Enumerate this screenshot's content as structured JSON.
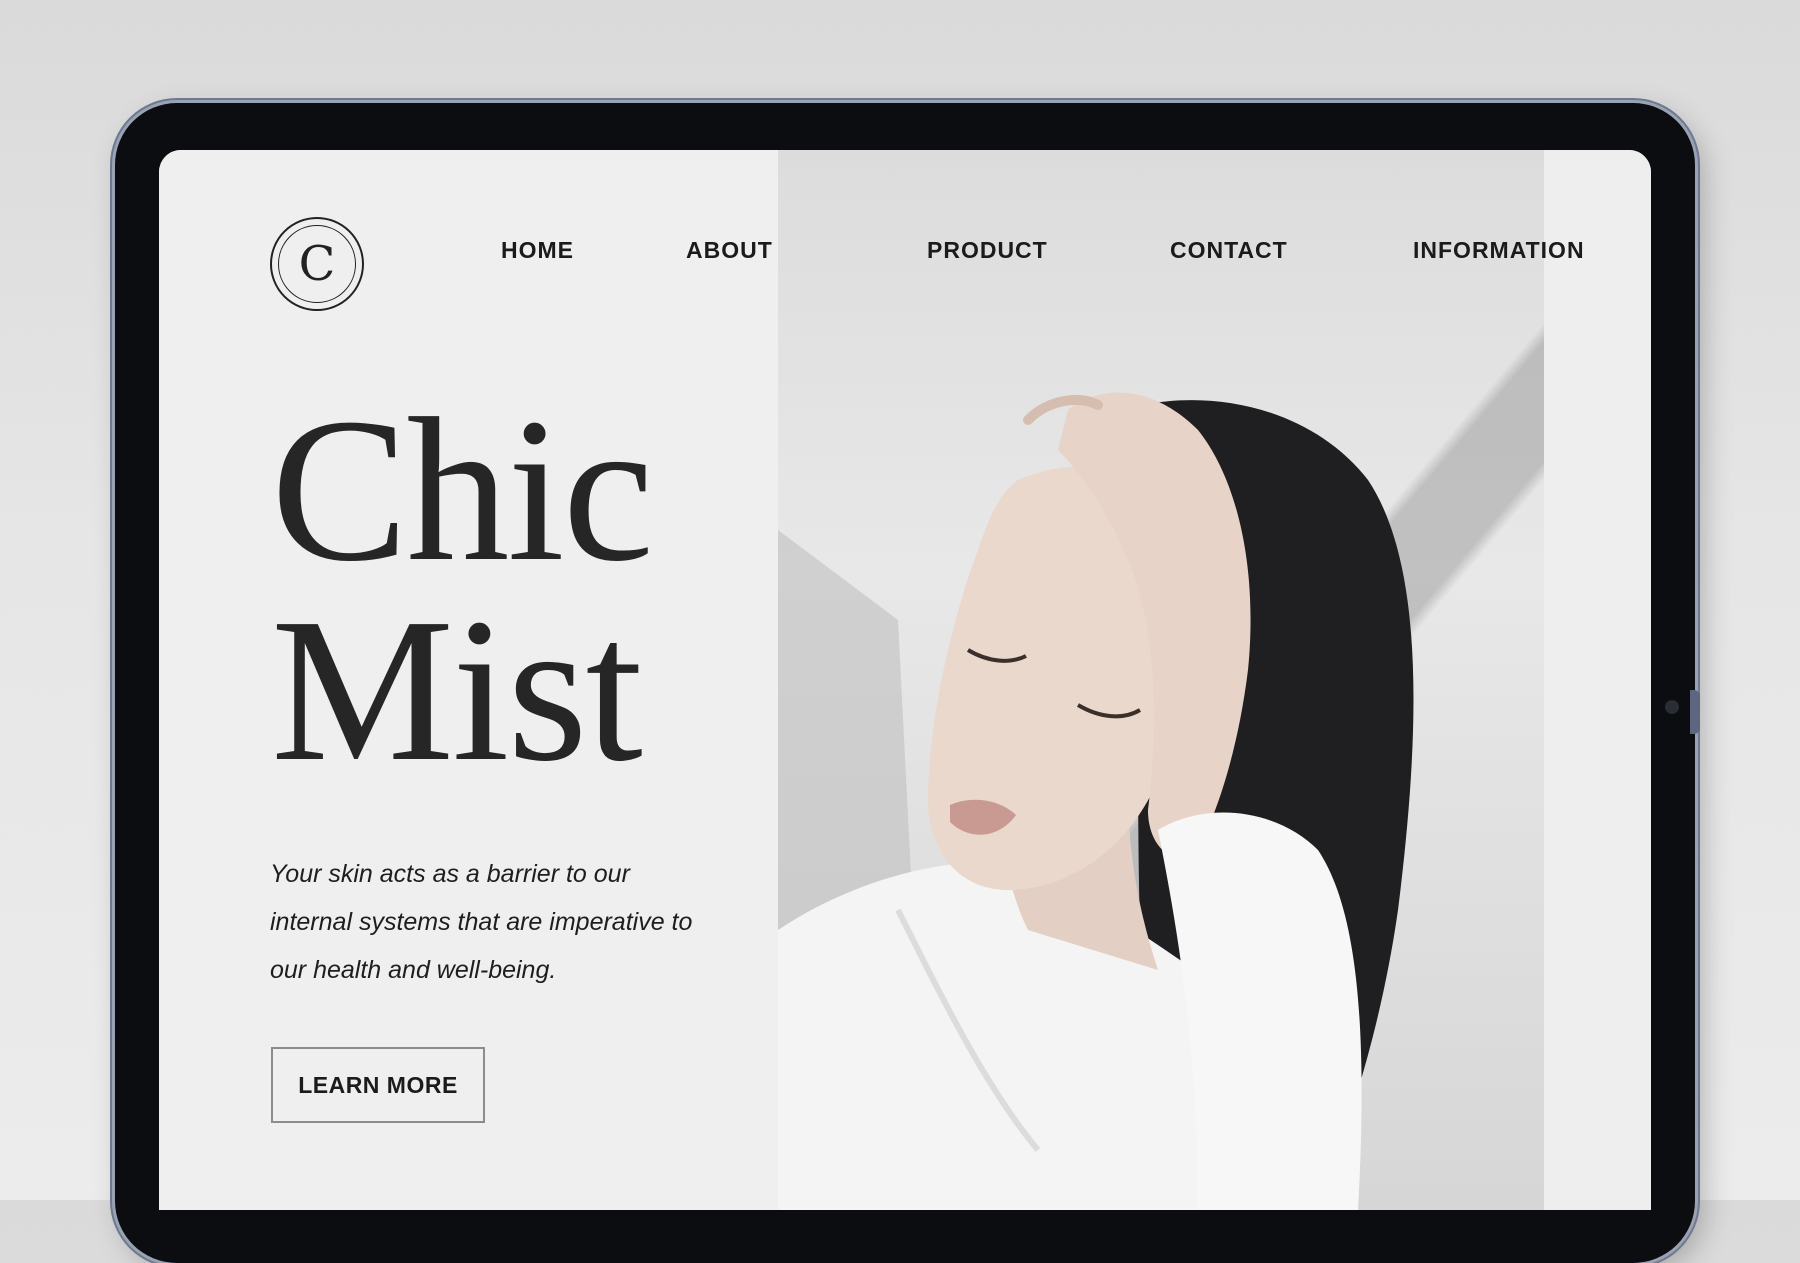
{
  "brand": {
    "logo_letter": "C"
  },
  "nav": {
    "items": [
      {
        "label": "HOME"
      },
      {
        "label": "ABOUT"
      },
      {
        "label": "PRODUCT"
      },
      {
        "label": "CONTACT"
      },
      {
        "label": "INFORMATION"
      }
    ]
  },
  "hero": {
    "title_line1": "Chic",
    "title_line2": "Mist",
    "tagline": "Your skin acts as a barrier to our internal systems that are imperative to our health and well-being.",
    "cta_label": "LEARN MORE"
  },
  "colors": {
    "background": "#efefef",
    "text": "#262626",
    "device_frame": "#0c0d10"
  }
}
